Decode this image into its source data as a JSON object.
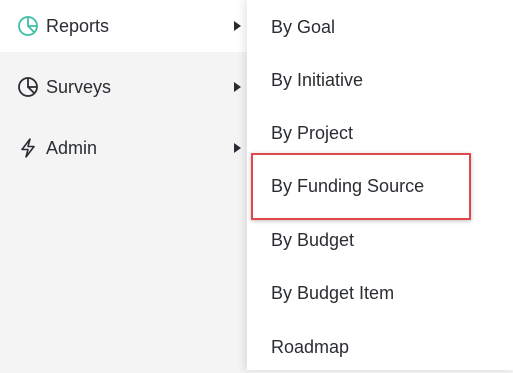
{
  "sidebar": {
    "items": [
      {
        "label": "Reports",
        "icon": "pie-chart-icon",
        "icon_color": "#3dbfa6",
        "active": true
      },
      {
        "label": "Surveys",
        "icon": "pie-chart-icon",
        "icon_color": "#2a2d31",
        "active": false
      },
      {
        "label": "Admin",
        "icon": "lightning-icon",
        "icon_color": "#2a2d31",
        "active": false
      }
    ]
  },
  "submenu": {
    "items": [
      {
        "label": "By Goal"
      },
      {
        "label": "By Initiative"
      },
      {
        "label": "By Project"
      },
      {
        "label": "By Funding Source",
        "highlighted": true
      },
      {
        "label": "By Budget"
      },
      {
        "label": "By Budget Item"
      },
      {
        "label": "Roadmap"
      }
    ],
    "highlight_color": "#e0474c"
  }
}
